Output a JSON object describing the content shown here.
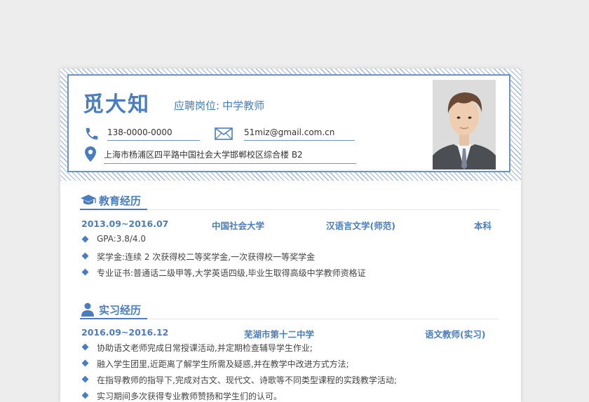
{
  "header": {
    "name": "觅大知",
    "position_label": "应聘岗位:",
    "position_value": "中学教师",
    "phone": "138-0000-0000",
    "email": "51miz@gmail.com.cn",
    "address": "上海市杨浦区四平路中国社会大学邯郸校区综合楼 B2"
  },
  "icons": {
    "phone": "phone-icon",
    "email": "envelope-icon",
    "address": "location-pin-icon",
    "education": "graduation-cap-icon",
    "internship": "person-icon"
  },
  "education": {
    "title": "教育经历",
    "period": "2013.09~2016.07",
    "school": "中国社会大学",
    "major": "汉语言文学(师范)",
    "degree": "本科",
    "bullets": [
      "GPA:3.8/4.0",
      "奖学金:连续 2 次获得校二等奖学金,一次获得校一等奖学金",
      "专业证书:普通话二级甲等,大学英语四级,毕业生取得高级中学教师资格证"
    ]
  },
  "internship": {
    "title": "实习经历",
    "period": "2016.09~2016.12",
    "company": "芜湖市第十二中学",
    "role": "语文教师(实习)",
    "bullets": [
      "协助语文老师完成日常授课活动,并定期检查辅导学生作业;",
      "融入学生团里,近距离了解学生所需及疑惑,并在教学中改进方式方法;",
      "在指导教师的指导下,完成对古文、现代文、诗歌等不同类型课程的实践教学活动;",
      "实习期间多次获得专业教师赞扬和学生们的认可。"
    ]
  },
  "colors": {
    "accent": "#4a7dbf",
    "border": "#6f93c8",
    "background": "#ededed"
  }
}
